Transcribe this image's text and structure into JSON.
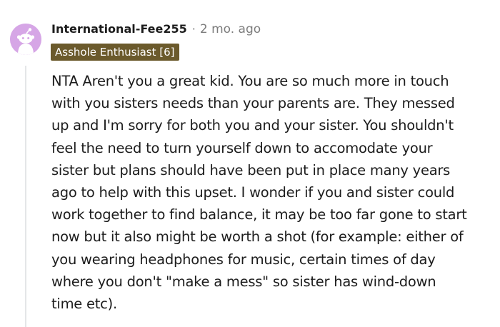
{
  "comment": {
    "username": "International-Fee255",
    "separator": "·",
    "timestamp": "2 mo. ago",
    "flair": "Asshole Enthusiast [6]",
    "avatar_icon": "snoo-avatar-icon",
    "colors": {
      "avatar_bg": "#d6a6e6",
      "flair_bg": "#6b5a2c",
      "text": "#1c1c1c",
      "meta": "#7c7c7c"
    },
    "body_lines": [
      "NTA Aren't you a great kid. You are so much more in touch",
      "with you sisters needs than your parents are. They messed",
      "up and I'm sorry for both you and your sister. You shouldn't",
      "feel the need to turn yourself down to accomodate your",
      "sister but plans should have been put in place many years",
      "ago to help with this upset. I wonder if you and sister could",
      "work together to find balance, it may be too far gone to start",
      "now but it also might be worth a shot (for example: either of",
      "you wearing headphones for music, certain times of day",
      "where you don't \"make a mess\" so sister has wind-down",
      "time etc)."
    ]
  }
}
